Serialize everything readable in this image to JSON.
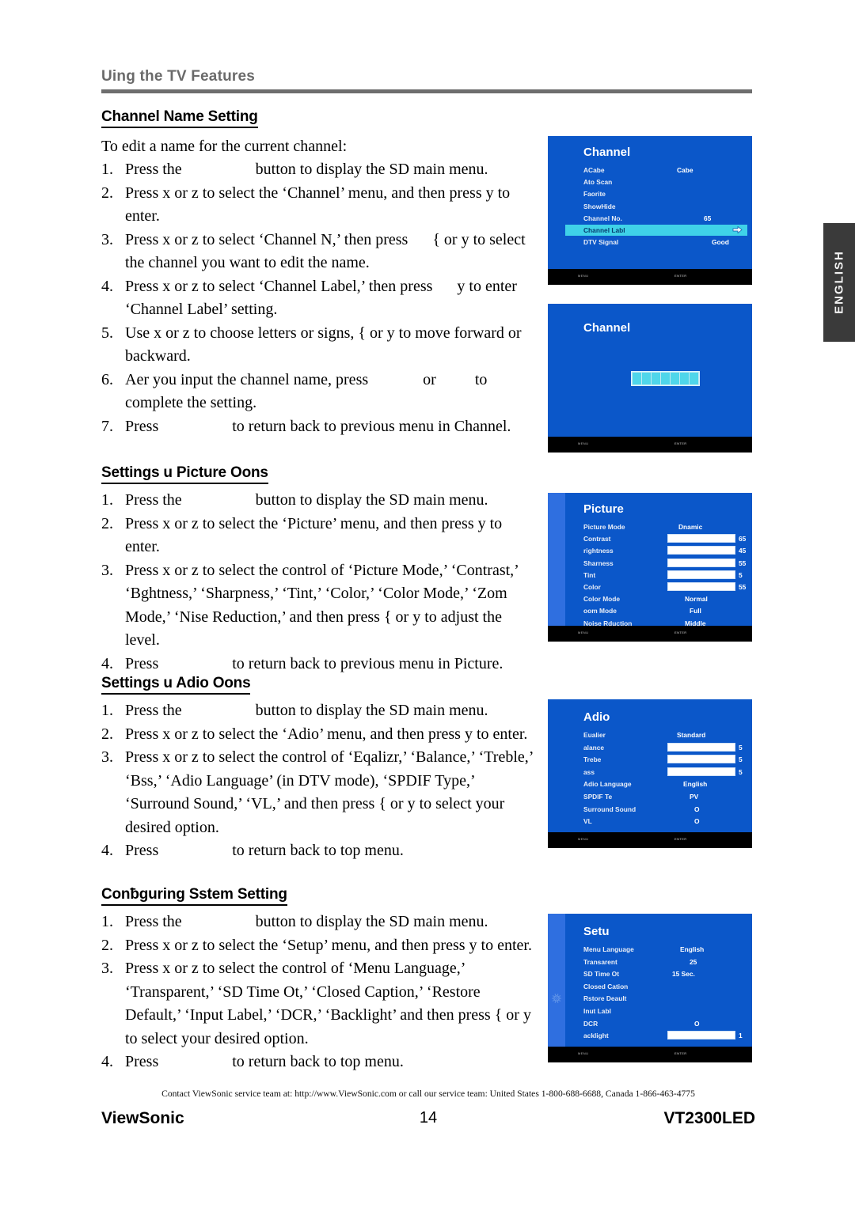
{
  "header": {
    "running_title": "Uing the TV Features"
  },
  "side_tab": {
    "label": "ENGLISH"
  },
  "sections": [
    {
      "heading": "Channel Name Setting",
      "intro": "To edit a name for the current channel:",
      "steps": [
        {
          "n": "1.",
          "parts": [
            "Press the",
            "GAP_MENU",
            "button to display the SD main menu."
          ]
        },
        {
          "n": "2.",
          "parts": [
            "Press x or z to select the ‘Channel’ menu, and then press y to enter."
          ]
        },
        {
          "n": "3.",
          "parts": [
            "Press x or z to select ‘Channel N,’ then press",
            "GAP_SM",
            "{ or y to select the channel you want to edit the name."
          ]
        },
        {
          "n": "4.",
          "parts": [
            "Press x or z to select ‘Channel Label,’ then press",
            "GAP_SM",
            "y to enter ‘Channel Label’ setting."
          ]
        },
        {
          "n": "5.",
          "parts": [
            "Use x or z to choose letters or signs, { or y to move forward or backward."
          ]
        },
        {
          "n": "6.",
          "parts": [
            "Aer you input the channel name, press",
            "GAP_ENTER",
            "or",
            "GAP_EXIT",
            "to complete the setting."
          ]
        },
        {
          "n": "7.",
          "parts": [
            "Press",
            "GAP_MENU",
            "to return back to previous menu in Channel."
          ]
        }
      ]
    },
    {
      "heading": "Settings u Picture Oons",
      "intro": "",
      "steps": [
        {
          "n": "1.",
          "parts": [
            "Press the",
            "GAP_MENU",
            "button to display the SD main menu."
          ]
        },
        {
          "n": "2.",
          "parts": [
            "Press x or z to select the ‘Picture’ menu, and then press y to enter."
          ]
        },
        {
          "n": "3.",
          "parts": [
            "Press x or z to select the control of ‘Picture Mode,’ ‘Contrast,’ ‘Bghtness,’ ‘Sharpness,’ ‘Tint,’ ‘Color,’ ‘Color Mode,’ ‘Zom Mode,’ ‘Nise Reduction,’ and then press { or y to adjust the level."
          ]
        },
        {
          "n": "4.",
          "parts": [
            "Press",
            "GAP_MENU",
            "to return back to previous menu in Picture."
          ]
        }
      ]
    },
    {
      "heading": "Settings u Adio Oons",
      "intro": "",
      "steps": [
        {
          "n": "1.",
          "parts": [
            "Press the",
            "GAP_MENU",
            "button to display the SD main menu."
          ]
        },
        {
          "n": "2.",
          "parts": [
            "Press x or z to select the ‘Adio’ menu, and then press y to enter."
          ]
        },
        {
          "n": "3.",
          "parts": [
            "Press x or z to select the control of ‘Eqalizr,’ ‘Balance,’ ‘Treble,’ ‘Bss,’ ‘Adio Language’ (in DTV mode), ‘SPDIF Type,’ ‘Surround Sound,’ ‘VL,’ and then press { or y to select your desired option."
          ]
        },
        {
          "n": "4.",
          "parts": [
            "Press",
            "GAP_MENU",
            "to return back to top menu."
          ]
        }
      ]
    },
    {
      "heading": "Conƀguring Sstem Setting",
      "intro": "",
      "steps": [
        {
          "n": "1.",
          "parts": [
            "Press the",
            "GAP_MENU",
            "button to display the SD main menu."
          ]
        },
        {
          "n": "2.",
          "parts": [
            "Press x or z to select the ‘Setup’ menu, and then press y to enter."
          ]
        },
        {
          "n": "3.",
          "parts": [
            "Press x or z to select the control of ‘Menu Language,’ ‘Transparent,’ ‘SD Time Ot,’ ‘Closed Caption,’ ‘Restore Default,’ ‘Input Label,’ ‘DCR,’ ‘Backlight’ and then press { or y to select your desired option."
          ]
        },
        {
          "n": "4.",
          "parts": [
            "Press",
            "GAP_MENU",
            "to return back to top menu."
          ]
        }
      ]
    }
  ],
  "osd": {
    "foot_left": "MENU",
    "foot_right": "ENTER",
    "channel_menu": {
      "title": "Channel",
      "rows": [
        {
          "label": "ACabe",
          "value": "Cabe",
          "value_x": 118
        },
        {
          "label": "Ato Scan",
          "value": "",
          "value_x": 118
        },
        {
          "label": "Faorite",
          "value": "",
          "value_x": 118
        },
        {
          "label": "ShowHide",
          "value": "",
          "value_x": 118
        },
        {
          "label": "Channel No.",
          "value": "65",
          "value_x": 152
        },
        {
          "label": "Channel Labl",
          "value": "",
          "value_x": 152,
          "selected": true,
          "arrow": true
        },
        {
          "label": "DTV Signal",
          "value": "Good",
          "value_x": 162
        }
      ]
    },
    "channel_label_edit": {
      "title": "Channel",
      "cells": 7
    },
    "picture_menu": {
      "title": "Picture",
      "rows": [
        {
          "label": "Picture Mode",
          "value": "Dnamic",
          "value_x": 120
        },
        {
          "label": "Contrast",
          "value": "65",
          "value_x": 196,
          "bar": 65
        },
        {
          "label": "rightness",
          "value": "45",
          "value_x": 196,
          "bar": 45
        },
        {
          "label": "Sharness",
          "value": "55",
          "value_x": 196,
          "bar": 55
        },
        {
          "label": "Tint",
          "value": "5",
          "value_x": 196,
          "bar": 5
        },
        {
          "label": "Color",
          "value": "55",
          "value_x": 196,
          "bar": 55
        },
        {
          "label": "Color Mode",
          "value": "Normal",
          "value_x": 128
        },
        {
          "label": "oom Mode",
          "value": "Full",
          "value_x": 134
        },
        {
          "label": "Noise Rduction",
          "value": "Middle",
          "value_x": 128
        }
      ]
    },
    "audio_menu": {
      "title": "Adio",
      "rows": [
        {
          "label": "Eualier",
          "value": "Standard",
          "value_x": 118
        },
        {
          "label": "alance",
          "value": "5",
          "value_x": 196,
          "bar": 50
        },
        {
          "label": "Trebe",
          "value": "5",
          "value_x": 196,
          "bar": 50
        },
        {
          "label": "ass",
          "value": "5",
          "value_x": 196,
          "bar": 50
        },
        {
          "label": "Adio Language",
          "value": "English",
          "value_x": 126
        },
        {
          "label": "SPDIF Te",
          "value": "PV",
          "value_x": 134
        },
        {
          "label": "Surround Sound",
          "value": "O",
          "value_x": 140
        },
        {
          "label": "VL",
          "value": "O",
          "value_x": 140
        }
      ]
    },
    "setup_menu": {
      "title": "Setu",
      "rows": [
        {
          "label": "Menu Language",
          "value": "English",
          "value_x": 122
        },
        {
          "label": "Transarent",
          "value": "25",
          "value_x": 134
        },
        {
          "label": "SD Time Ot",
          "value": "15 Sec.",
          "value_x": 112
        },
        {
          "label": "Closed Cation",
          "value": "",
          "value_x": 122
        },
        {
          "label": "Rstore Deault",
          "value": "",
          "value_x": 122
        },
        {
          "label": "Inut Labl",
          "value": "",
          "value_x": 122
        },
        {
          "label": "DCR",
          "value": "O",
          "value_x": 140
        },
        {
          "label": "acklight",
          "value": "1",
          "value_x": 196,
          "bar": 100
        }
      ]
    }
  },
  "footer": {
    "note": "Contact ViewSonic service team at: http://www.ViewSonic.com or call our service team: United States 1-800-688-6688, Canada 1-866-463-4775",
    "brand": "ViewSonic",
    "page_number": "14",
    "model": "VT2300LED"
  }
}
